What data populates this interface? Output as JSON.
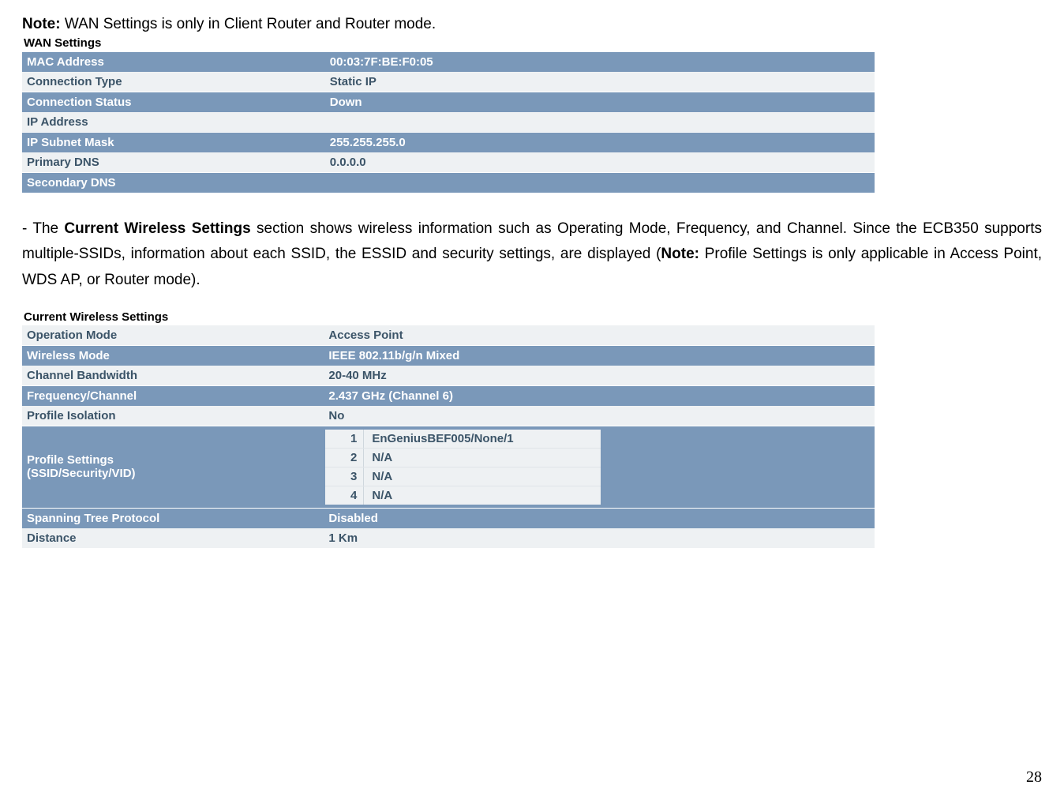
{
  "top_note": {
    "prefix": "Note:",
    "text": " WAN Settings is only in Client Router and Router mode."
  },
  "wan": {
    "title": "WAN Settings",
    "rows": [
      {
        "label": "MAC Address",
        "value": "00:03:7F:BE:F0:05"
      },
      {
        "label": "Connection Type",
        "value": "Static IP"
      },
      {
        "label": "Connection Status",
        "value": "Down"
      },
      {
        "label": "IP Address",
        "value": ""
      },
      {
        "label": "IP Subnet Mask",
        "value": "255.255.255.0"
      },
      {
        "label": "Primary DNS",
        "value": "0.0.0.0"
      },
      {
        "label": "Secondary DNS",
        "value": ""
      }
    ]
  },
  "paragraph": {
    "lead_dash": "-  The ",
    "bold1": "Current Wireless Settings",
    "mid1": " section shows wireless information such as Operating Mode, Frequency, and Channel. Since the ECB350 supports multiple-SSIDs, information about each SSID, the ESSID and security settings, are displayed (",
    "bold2": "Note:",
    "tail": " Profile Settings is only applicable in Access Point, WDS AP, or Router mode)."
  },
  "wireless": {
    "title": "Current Wireless Settings",
    "rows": [
      {
        "label": "Operation Mode",
        "value": "Access Point"
      },
      {
        "label": "Wireless Mode",
        "value": "IEEE 802.11b/g/n Mixed"
      },
      {
        "label": "Channel Bandwidth",
        "value": "20-40 MHz"
      },
      {
        "label": "Frequency/Channel",
        "value": "2.437 GHz (Channel 6)"
      },
      {
        "label": "Profile Isolation",
        "value": "No"
      }
    ],
    "profile_label_l1": "Profile Settings",
    "profile_label_l2": "(SSID/Security/VID)",
    "profiles": [
      {
        "idx": "1",
        "val": "EnGeniusBEF005/None/1"
      },
      {
        "idx": "2",
        "val": "N/A"
      },
      {
        "idx": "3",
        "val": "N/A"
      },
      {
        "idx": "4",
        "val": "N/A"
      }
    ],
    "rows_tail": [
      {
        "label": "Spanning Tree Protocol",
        "value": "Disabled"
      },
      {
        "label": "Distance",
        "value": "1 Km"
      }
    ]
  },
  "page_number": "28"
}
